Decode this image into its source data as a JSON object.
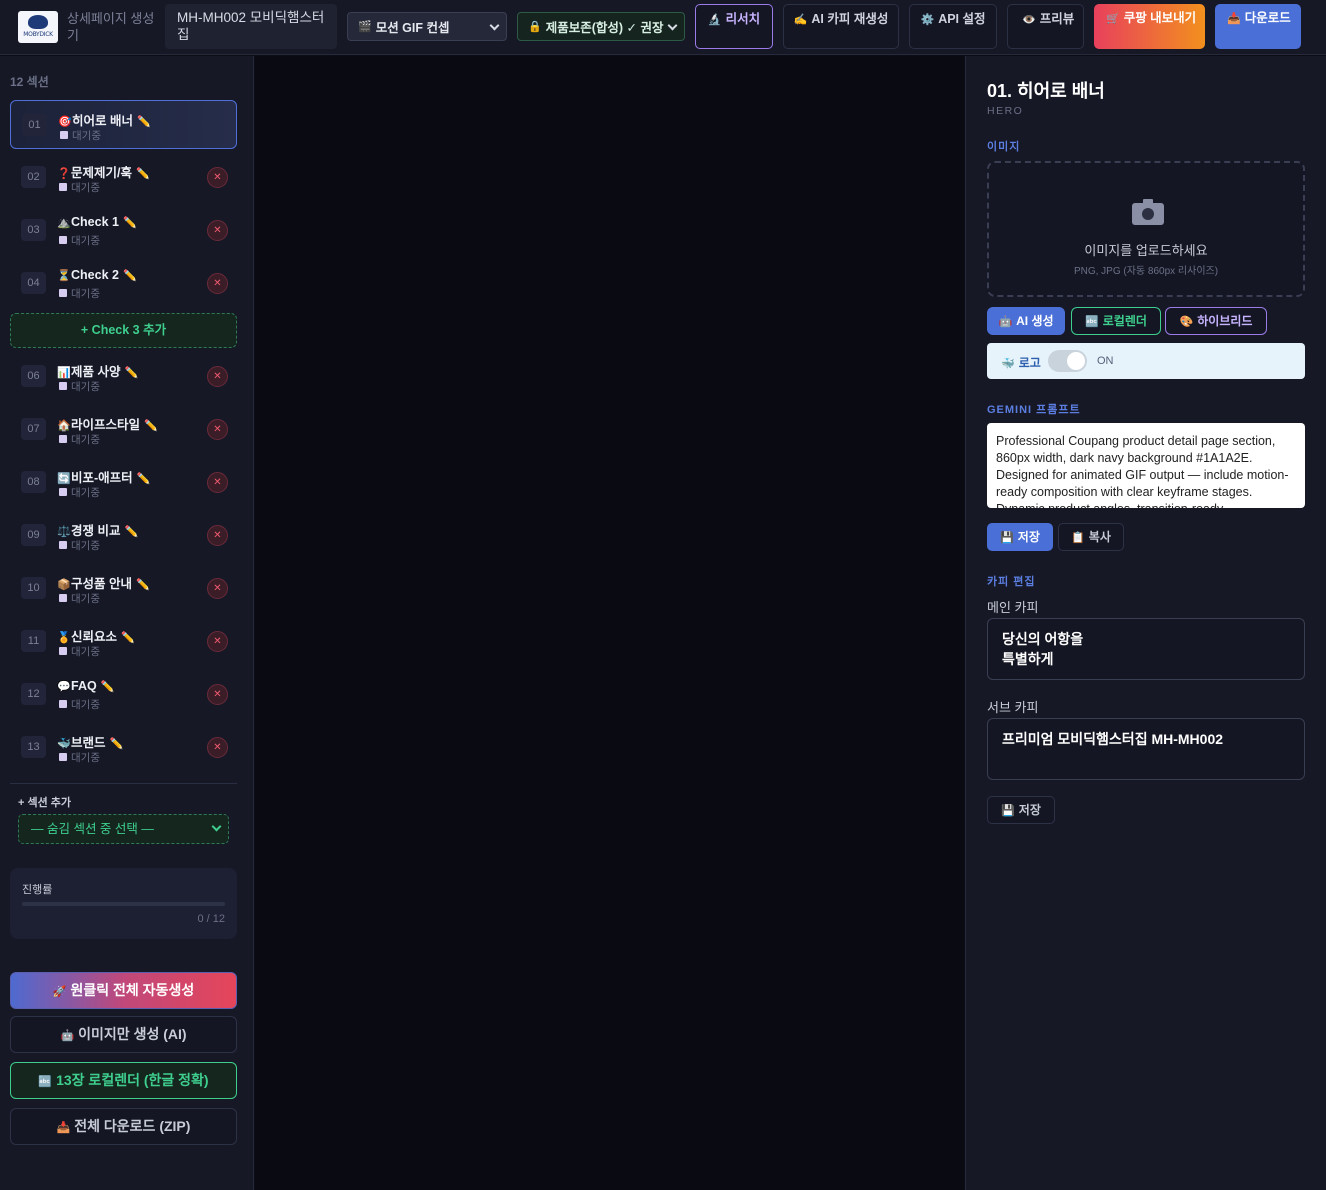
{
  "header": {
    "logo_text": "MOBYDICK",
    "app_title": "상세페이지 생성기",
    "project_name": "MH-MH002 모비딕햄스터집",
    "gif_concept": "모션 GIF 컨셉",
    "gif_icon": "🎬",
    "protect_mode": "제품보존(합성) ✓ 권장",
    "protect_icon": "🔒",
    "buttons": {
      "research": "리서치",
      "research_icon": "🔬",
      "ai_copy": "AI 카피 재생성",
      "ai_copy_icon": "✍️",
      "api": "API 설정",
      "api_icon": "⚙️",
      "preview": "프리뷰",
      "preview_icon": "👁️",
      "coupang": "쿠팡 내보내기",
      "coupang_icon": "🛒",
      "download": "다운로드",
      "download_icon": "📥"
    }
  },
  "sidebar": {
    "section_count": "12 섹션",
    "sections": [
      {
        "num": "01",
        "icon": "🎯",
        "name": "히어로 배너",
        "status": "대기중"
      },
      {
        "num": "02",
        "icon": "❓",
        "name": "문제제기/훅",
        "status": "대기중"
      },
      {
        "num": "03",
        "icon": "⛰️",
        "name": "Check 1",
        "status": "대기중"
      },
      {
        "num": "04",
        "icon": "⏳",
        "name": "Check 2",
        "status": "대기중"
      },
      {
        "num": "06",
        "icon": "📊",
        "name": "제품 사양",
        "status": "대기중"
      },
      {
        "num": "07",
        "icon": "🏠",
        "name": "라이프스타일",
        "status": "대기중"
      },
      {
        "num": "08",
        "icon": "🔄",
        "name": "비포-애프터",
        "status": "대기중"
      },
      {
        "num": "09",
        "icon": "⚖️",
        "name": "경쟁 비교",
        "status": "대기중"
      },
      {
        "num": "10",
        "icon": "📦",
        "name": "구성품 안내",
        "status": "대기중"
      },
      {
        "num": "11",
        "icon": "🏅",
        "name": "신뢰요소",
        "status": "대기중"
      },
      {
        "num": "12",
        "icon": "💬",
        "name": "FAQ",
        "status": "대기중"
      },
      {
        "num": "13",
        "icon": "🐳",
        "name": "브랜드",
        "status": "대기중"
      }
    ],
    "edit_icon": "✏️",
    "delete_icon": "✕",
    "add_check": "+ Check 3 추가",
    "add_section_label": "+ 섹션 추가",
    "hidden_section_select": "— 숨김 섹션 중 선택 —",
    "progress": {
      "label": "진행률",
      "count": "0 / 12",
      "fraction": 0
    },
    "actions": {
      "auto_all": "원클릭 전체 자동생성",
      "auto_all_icon": "🚀",
      "image_only": "이미지만 생성 (AI)",
      "image_only_icon": "🤖",
      "local_render": "13장 로컬렌더 (한글 정확)",
      "local_render_icon": "🔤",
      "zip": "전체 다운로드 (ZIP)",
      "zip_icon": "📥"
    }
  },
  "panel": {
    "title": "01. 히어로 배너",
    "subtitle": "HERO",
    "image_label": "이미지",
    "upload_text": "이미지를 업로드하세요",
    "upload_hint": "PNG, JPG (자동 860px 리사이즈)",
    "mode_ai": "AI 생성",
    "mode_ai_icon": "🤖",
    "mode_local": "로컬렌더",
    "mode_local_icon": "🔤",
    "mode_hybrid": "하이브리드",
    "mode_hybrid_icon": "🎨",
    "logo_label": "로고",
    "logo_icon": "🐳",
    "logo_state": "ON",
    "logo_on": true,
    "prompt_label": "GEMINI 프롬프트",
    "prompt_text": "Professional Coupang product detail page section, 860px width, dark navy background #1A1A2E. Designed for animated GIF output — include motion-ready composition with clear keyframe stages. Dynamic product angles, transition-ready",
    "save": "저장",
    "save_icon": "💾",
    "copy": "복사",
    "copy_icon": "📋",
    "copy_edit_label": "카피 편집",
    "main_copy_label": "메인 카피",
    "main_copy_line1": "당신의 어항을",
    "main_copy_line2": "특별하게",
    "sub_copy_label": "서브 카피",
    "sub_copy": "프리미엄 모비딕햄스터집 MH-MH002",
    "save2": "저장"
  }
}
